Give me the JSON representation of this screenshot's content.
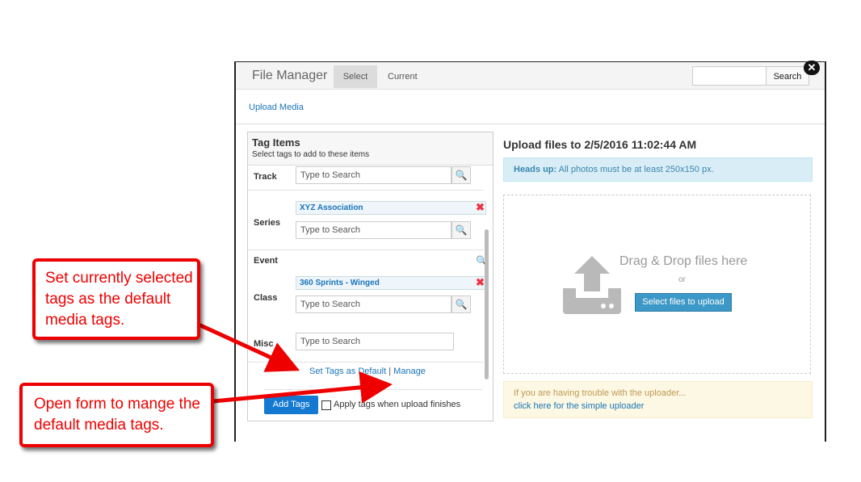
{
  "window": {
    "title": "File Manager",
    "tabs": [
      {
        "label": "Select",
        "active": true
      },
      {
        "label": "Current",
        "active": false
      }
    ],
    "search": {
      "value": "",
      "button_label": "Search"
    },
    "close_label": "✕"
  },
  "upload_media_label": "Upload Media",
  "tag_panel": {
    "title": "Tag Items",
    "subtitle": "Select tags to add to these items",
    "rows": {
      "track": {
        "label": "Track",
        "placeholder": "Type to Search"
      },
      "series": {
        "label": "Series",
        "tag": "XYZ Association",
        "placeholder": "Type to Search"
      },
      "event": {
        "label": "Event"
      },
      "class": {
        "label": "Class",
        "tag": "360 Sprints - Winged",
        "placeholder": "Type to Search"
      },
      "misc": {
        "label": "Misc",
        "placeholder": "Type to Search"
      }
    },
    "set_default_label": "Set Tags as Default",
    "separator": "|",
    "manage_label": "Manage",
    "add_tags_label": "Add Tags",
    "apply_label": "Apply tags when upload finishes",
    "apply_checked": false
  },
  "upload": {
    "title": "Upload files to 2/5/2016 11:02:44 AM",
    "alert_strong": "Heads up:",
    "alert_text": "All photos must be at least 250x150 px.",
    "drop_text": "Drag & Drop files here",
    "or_text": "or",
    "select_files_label": "Select files to upload",
    "trouble_text": "If you are having trouble with the uploader...",
    "simple_link": "click here for the simple uploader"
  },
  "callouts": {
    "one": "Set currently selected tags as the default media tags.",
    "two": "Open form to mange the default media tags."
  },
  "colors": {
    "accent": "#1a74b8",
    "callout": "#e00000",
    "button_primary": "#1479d1"
  }
}
